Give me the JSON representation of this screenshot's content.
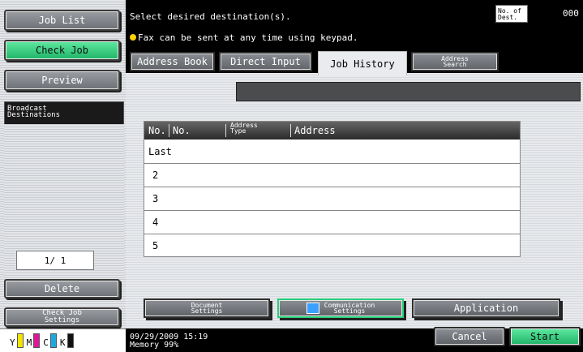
{
  "left_nav": {
    "job_list": "Job List",
    "check_job": "Check Job",
    "preview": "Preview",
    "broadcast_line1": "Broadcast",
    "broadcast_line2": "Destinations",
    "page_count": "1/ 1",
    "delete": "Delete",
    "check_job_settings_line1": "Check Job",
    "check_job_settings_line2": "Settings"
  },
  "toner": [
    {
      "label": "Y",
      "color": "#f2e600"
    },
    {
      "label": "M",
      "color": "#e0169a"
    },
    {
      "label": "C",
      "color": "#1fa8e0"
    },
    {
      "label": "K",
      "color": "#111111"
    }
  ],
  "header": {
    "message": "Select desired destination(s).",
    "fax_note": "Fax can be sent at any time using keypad.",
    "dest_label_line1": "No. of",
    "dest_label_line2": "Dest.",
    "dest_count": "000"
  },
  "tabs": {
    "address_book": "Address Book",
    "direct_input": "Direct Input",
    "job_history": "Job History",
    "address_search_line1": "Address",
    "address_search_line2": "Search"
  },
  "table": {
    "headers": {
      "no1": "No.",
      "no2": "No.",
      "type_line1": "Address",
      "type_line2": "Type",
      "address": "Address"
    },
    "rows": [
      "Last",
      "2",
      "3",
      "4",
      "5"
    ]
  },
  "bottom_buttons": {
    "doc_line1": "Document",
    "doc_line2": "Settings",
    "comm_line1": "Communication",
    "comm_line2": "Settings",
    "application": "Application"
  },
  "status": {
    "datetime": "09/29/2009   15:19",
    "memory": "Memory        99%"
  },
  "actions": {
    "cancel": "Cancel",
    "start": "Start"
  }
}
